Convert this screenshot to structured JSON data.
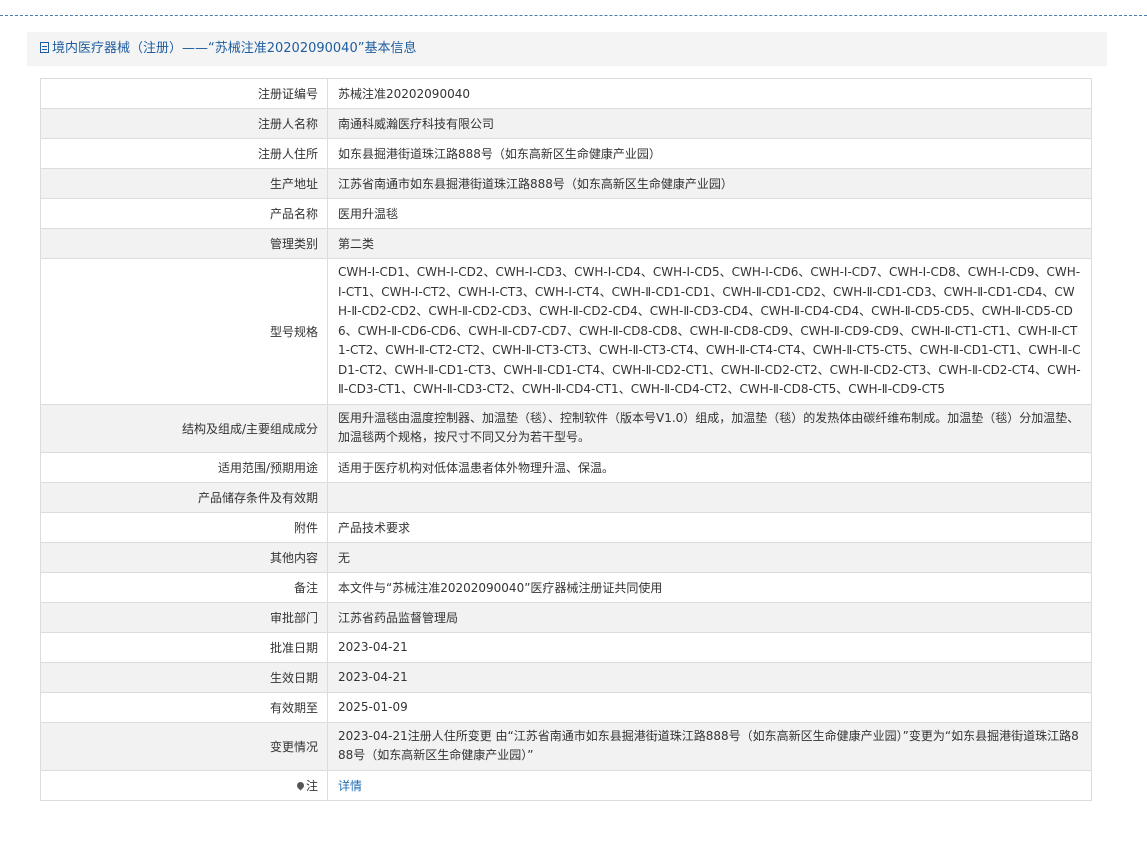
{
  "header": {
    "title": "境内医疗器械（注册）——“苏械注准20202090040”基本信息",
    "icon": "document-icon"
  },
  "rows": [
    {
      "label": "注册证编号",
      "value": "苏械注准20202090040"
    },
    {
      "label": "注册人名称",
      "value": "南通科威瀚医疗科技有限公司"
    },
    {
      "label": "注册人住所",
      "value": "如东县掘港街道珠江路888号（如东高新区生命健康产业园）"
    },
    {
      "label": "生产地址",
      "value": "江苏省南通市如东县掘港街道珠江路888号（如东高新区生命健康产业园）"
    },
    {
      "label": "产品名称",
      "value": "医用升温毯"
    },
    {
      "label": "管理类别",
      "value": "第二类"
    },
    {
      "label": "型号规格",
      "value": "CWH-Ⅰ-CD1、CWH-Ⅰ-CD2、CWH-Ⅰ-CD3、CWH-Ⅰ-CD4、CWH-Ⅰ-CD5、CWH-Ⅰ-CD6、CWH-Ⅰ-CD7、CWH-Ⅰ-CD8、CWH-Ⅰ-CD9、CWH-Ⅰ-CT1、CWH-Ⅰ-CT2、CWH-Ⅰ-CT3、CWH-Ⅰ-CT4、CWH-Ⅱ-CD1-CD1、CWH-Ⅱ-CD1-CD2、CWH-Ⅱ-CD1-CD3、CWH-Ⅱ-CD1-CD4、CWH-Ⅱ-CD2-CD2、CWH-Ⅱ-CD2-CD3、CWH-Ⅱ-CD2-CD4、CWH-Ⅱ-CD3-CD4、CWH-Ⅱ-CD4-CD4、CWH-Ⅱ-CD5-CD5、CWH-Ⅱ-CD5-CD6、CWH-Ⅱ-CD6-CD6、CWH-Ⅱ-CD7-CD7、CWH-Ⅱ-CD8-CD8、CWH-Ⅱ-CD8-CD9、CWH-Ⅱ-CD9-CD9、CWH-Ⅱ-CT1-CT1、CWH-Ⅱ-CT1-CT2、CWH-Ⅱ-CT2-CT2、CWH-Ⅱ-CT3-CT3、CWH-Ⅱ-CT3-CT4、CWH-Ⅱ-CT4-CT4、CWH-Ⅱ-CT5-CT5、CWH-Ⅱ-CD1-CT1、CWH-Ⅱ-CD1-CT2、CWH-Ⅱ-CD1-CT3、CWH-Ⅱ-CD1-CT4、CWH-Ⅱ-CD2-CT1、CWH-Ⅱ-CD2-CT2、CWH-Ⅱ-CD2-CT3、CWH-Ⅱ-CD2-CT4、CWH-Ⅱ-CD3-CT1、CWH-Ⅱ-CD3-CT2、CWH-Ⅱ-CD4-CT1、CWH-Ⅱ-CD4-CT2、CWH-Ⅱ-CD8-CT5、CWH-Ⅱ-CD9-CT5"
    },
    {
      "label": "结构及组成/主要组成成分",
      "value": "医用升温毯由温度控制器、加温垫（毯）、控制软件（版本号V1.0）组成，加温垫（毯）的发热体由碳纤维布制成。加温垫（毯）分加温垫、加温毯两个规格，按尺寸不同又分为若干型号。"
    },
    {
      "label": "适用范围/预期用途",
      "value": "适用于医疗机构对低体温患者体外物理升温、保温。"
    },
    {
      "label": "产品储存条件及有效期",
      "value": ""
    },
    {
      "label": "附件",
      "value": "产品技术要求"
    },
    {
      "label": "其他内容",
      "value": "无"
    },
    {
      "label": "备注",
      "value": "本文件与“苏械注准20202090040”医疗器械注册证共同使用"
    },
    {
      "label": "审批部门",
      "value": "江苏省药品监督管理局"
    },
    {
      "label": "批准日期",
      "value": "2023-04-21"
    },
    {
      "label": "生效日期",
      "value": "2023-04-21"
    },
    {
      "label": "有效期至",
      "value": "2025-01-09"
    },
    {
      "label": "变更情况",
      "value": "2023-04-21注册人住所变更 由“江苏省南通市如东县掘港街道珠江路888号（如东高新区生命健康产业园）”变更为“如东县掘港街道珠江路888号（如东高新区生命健康产业园）”"
    },
    {
      "label": "注",
      "value": "详情",
      "icon": "map-pin-icon"
    }
  ],
  "colors": {
    "header_text": "#1f5d9e",
    "link": "#1f6fb5",
    "alt_row": "#f2f2f2",
    "border": "#dcdcdc"
  }
}
